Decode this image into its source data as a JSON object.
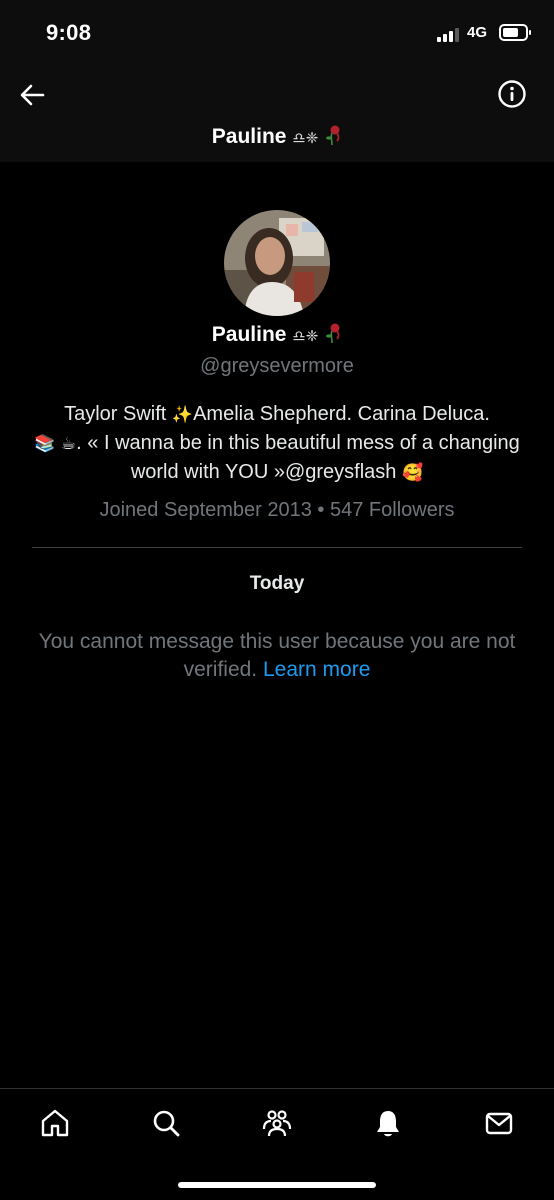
{
  "status_bar": {
    "time": "9:08",
    "network": "4G"
  },
  "header": {
    "title": "Pauline",
    "title_symbols": "♎︎❈"
  },
  "profile": {
    "name": "Pauline",
    "name_symbols": "♎︎❈",
    "handle": "@greysevermore",
    "bio_part1": "Taylor Swift ",
    "bio_sparkles": "✨",
    "bio_part2": "Amelia Shepherd. Carina Deluca.",
    "bio_books": "📚",
    "bio_coffee": "☕",
    "bio_part3": ". « I wanna be in this beautiful mess of a changing world with YOU »@greysflash ",
    "bio_smile": "🥰",
    "joined": "Joined September 2013",
    "separator": "•",
    "followers": "547 Followers"
  },
  "conversation": {
    "date_label": "Today",
    "notice_text": "You cannot message this user because you are not verified.",
    "learn_more": "Learn more"
  },
  "bottom_nav": {
    "items": [
      "home-icon",
      "search-icon",
      "communities-icon",
      "notifications-icon",
      "messages-icon"
    ]
  },
  "colors": {
    "background": "#000000",
    "header_background": "#0d0d0d",
    "secondary_text": "#71767b",
    "link": "#1d9bf0"
  }
}
